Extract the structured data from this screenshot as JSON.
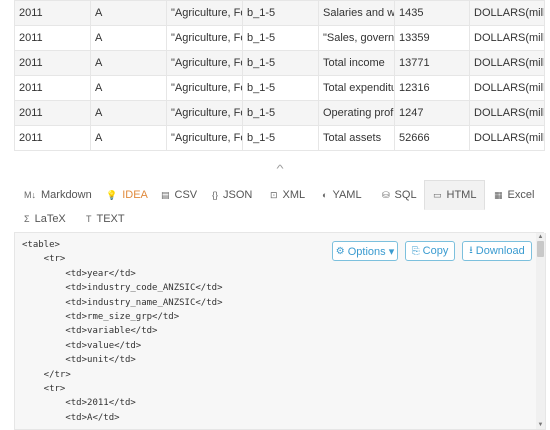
{
  "table": {
    "rows": [
      [
        "2011",
        "A",
        "\"Agriculture, Fo",
        "b_1-5",
        "Salaries and wa",
        "1435",
        "DOLLARS(millic"
      ],
      [
        "2011",
        "A",
        "\"Agriculture, Fo",
        "b_1-5",
        "\"Sales, governr",
        "13359",
        "DOLLARS(millic"
      ],
      [
        "2011",
        "A",
        "\"Agriculture, Fo",
        "b_1-5",
        "Total income",
        "13771",
        "DOLLARS(millic"
      ],
      [
        "2011",
        "A",
        "\"Agriculture, Fo",
        "b_1-5",
        "Total expenditu",
        "12316",
        "DOLLARS(millic"
      ],
      [
        "2011",
        "A",
        "\"Agriculture, Fo",
        "b_1-5",
        "Operating prof",
        "1247",
        "DOLLARS(millic"
      ],
      [
        "2011",
        "A",
        "\"Agriculture, Fo",
        "b_1-5",
        "Total assets",
        "52666",
        "DOLLARS(millic"
      ]
    ]
  },
  "collapse_icon": "chevron-up-icon",
  "tabs": {
    "markdown": {
      "label": "Markdown",
      "icon": "M↓"
    },
    "idea": {
      "label": "IDEA",
      "icon": "💡"
    },
    "csv": {
      "label": "CSV",
      "icon": "▤"
    },
    "json": {
      "label": "JSON",
      "icon": "{}"
    },
    "xml": {
      "label": "XML",
      "icon": "⊡"
    },
    "yaml": {
      "label": "YAML",
      "icon": "◐"
    },
    "sql": {
      "label": "SQL",
      "icon": "⛁"
    },
    "html": {
      "label": "HTML",
      "icon": "▭"
    },
    "excel": {
      "label": "Excel",
      "icon": "▦"
    },
    "latex": {
      "label": "LaTeX",
      "icon": "Σ"
    },
    "text": {
      "label": "TEXT",
      "icon": "T"
    }
  },
  "active_tab": "IDEA",
  "buttons": {
    "options": {
      "label": "Options ▾",
      "icon": "⚙"
    },
    "copy": {
      "label": "Copy",
      "icon": "⎘"
    },
    "download": {
      "label": "Download",
      "icon": "⭳"
    }
  },
  "code_lines": [
    "<table>",
    "    <tr>",
    "        <td>year</td>",
    "        <td>industry_code_ANZSIC</td>",
    "        <td>industry_name_ANZSIC</td>",
    "        <td>rme_size_grp</td>",
    "        <td>variable</td>",
    "        <td>value</td>",
    "        <td>unit</td>",
    "    </tr>",
    "    <tr>",
    "        <td>2011</td>",
    "        <td>A</td>"
  ],
  "colors": {
    "accent": "#e08a3c",
    "button": "#3a9bd0"
  }
}
